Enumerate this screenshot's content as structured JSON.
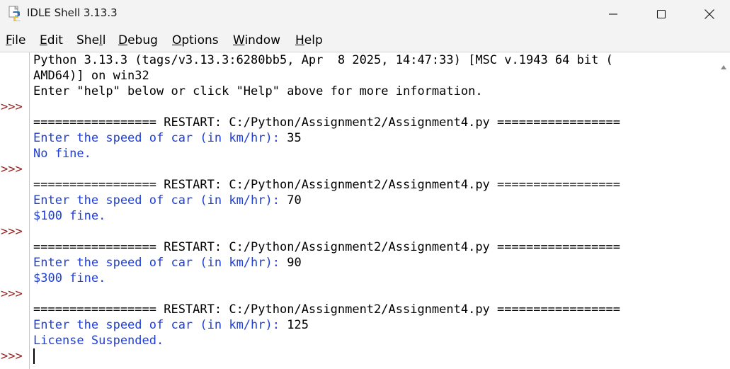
{
  "window": {
    "title": "IDLE Shell 3.13.3"
  },
  "menu": [
    {
      "pre": "",
      "ul": "F",
      "post": "ile",
      "name": "menu-file"
    },
    {
      "pre": "",
      "ul": "E",
      "post": "dit",
      "name": "menu-edit"
    },
    {
      "pre": "She",
      "ul": "l",
      "post": "l",
      "name": "menu-shell"
    },
    {
      "pre": "",
      "ul": "D",
      "post": "ebug",
      "name": "menu-debug"
    },
    {
      "pre": "",
      "ul": "O",
      "post": "ptions",
      "name": "menu-options"
    },
    {
      "pre": "",
      "ul": "W",
      "post": "indow",
      "name": "menu-window"
    },
    {
      "pre": "",
      "ul": "H",
      "post": "elp",
      "name": "menu-help"
    }
  ],
  "shell": {
    "prompt": ">>>",
    "banner_1": "Python 3.13.3 (tags/v3.13.3:6280bb5, Apr  8 2025, 14:47:33) [MSC v.1943 64 bit (",
    "banner_2": "AMD64)] on win32",
    "banner_3": "Enter \"help\" below or click \"Help\" above for more information.",
    "restart": "================= RESTART: C:/Python/Assignment2/Assignment4.py =================",
    "question": "Enter the speed of car (in km/hr): ",
    "runs": [
      {
        "input": "35",
        "result": "No fine."
      },
      {
        "input": "70",
        "result": "$100 fine."
      },
      {
        "input": "90",
        "result": "$300 fine."
      },
      {
        "input": "125",
        "result": "License Suspended."
      }
    ]
  },
  "colors": {
    "prompt": "#9b1c1c",
    "program_output": "#1f3fd6",
    "text": "#000000"
  }
}
